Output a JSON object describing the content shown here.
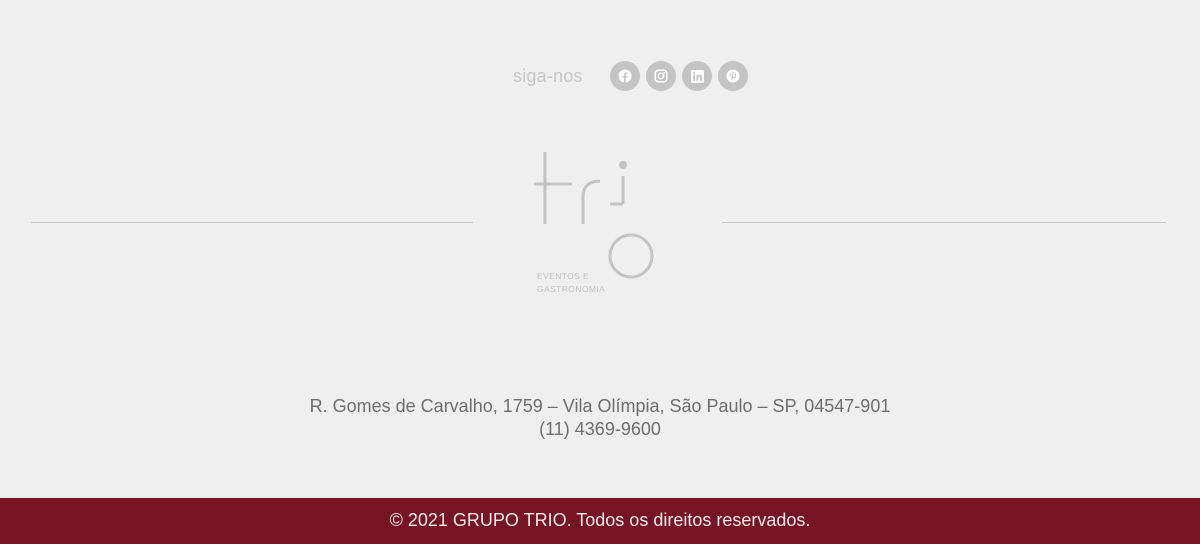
{
  "social": {
    "follow_label": "siga-nos",
    "buttons": [
      {
        "icon": "facebook-icon"
      },
      {
        "icon": "instagram-icon"
      },
      {
        "icon": "linkedin-icon"
      },
      {
        "icon": "pinterest-icon"
      }
    ]
  },
  "logo": {
    "wordmark": "trio",
    "tagline_line1": "EVENTOS E",
    "tagline_line2": "GASTRONOMIA"
  },
  "contact": {
    "address": "R. Gomes de Carvalho, 1759 – Vila Olímpia, São Paulo – SP, 04547-901",
    "phone": "(11) 4369-9600"
  },
  "footer": {
    "copyright": "© 2021 GRUPO TRIO. Todos os direitos reservados."
  },
  "colors": {
    "background": "#efefef",
    "footer_bar": "#771424",
    "icon_circle": "#c4c4c4",
    "logo_gray": "#c4c4c4",
    "text_gray": "#6e6e6e"
  }
}
